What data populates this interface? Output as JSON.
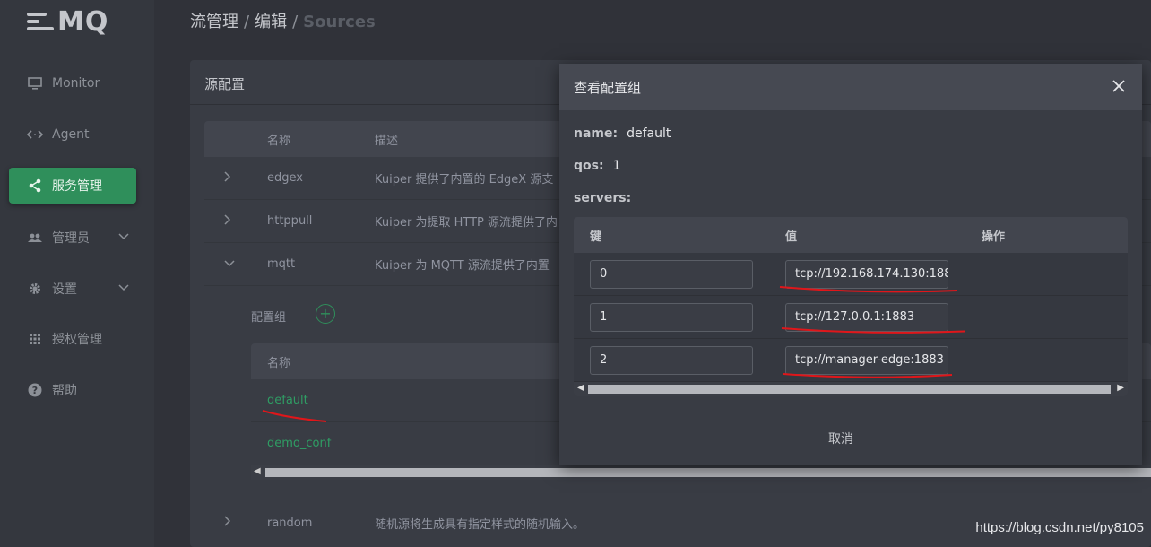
{
  "sidebar": {
    "logo": "MQ",
    "items": [
      {
        "label": "Monitor",
        "icon": "monitor-icon"
      },
      {
        "label": "Agent",
        "icon": "code-icon"
      },
      {
        "label": "服务管理",
        "icon": "share-icon",
        "active": true
      },
      {
        "label": "管理员",
        "icon": "users-icon",
        "expandable": true
      },
      {
        "label": "设置",
        "icon": "gear-icon",
        "expandable": true
      },
      {
        "label": "授权管理",
        "icon": "grid-icon"
      },
      {
        "label": "帮助",
        "icon": "help-icon"
      }
    ]
  },
  "breadcrumb": {
    "items": [
      "流管理",
      "编辑"
    ],
    "current": "Sources",
    "separator": "/"
  },
  "card": {
    "title": "源配置",
    "table": {
      "headers": [
        "名称",
        "描述"
      ],
      "rows": [
        {
          "name": "edgex",
          "desc": "Kuiper 提供了内置的 EdgeX 源支"
        },
        {
          "name": "httppull",
          "desc": "Kuiper 为提取 HTTP 源流提供了内"
        },
        {
          "name": "mqtt",
          "desc": "Kuiper 为 MQTT 源流提供了内置"
        }
      ],
      "random_row": {
        "name": "random",
        "desc": "随机源将生成具有指定样式的随机输入。"
      }
    },
    "config_group": {
      "label": "配置组",
      "add": "+",
      "header": "名称",
      "rows": [
        "default",
        "demo_conf"
      ]
    }
  },
  "modal": {
    "title": "查看配置组",
    "close": "×",
    "fields": [
      {
        "key": "name:",
        "value": "default"
      },
      {
        "key": "qos:",
        "value": "1"
      }
    ],
    "servers_label": "servers:",
    "servers": {
      "headers": [
        "键",
        "值",
        "操作"
      ],
      "rows": [
        {
          "key": "0",
          "value": "tcp://192.168.174.130:188"
        },
        {
          "key": "1",
          "value": "tcp://127.0.0.1:1883"
        },
        {
          "key": "2",
          "value": "tcp://manager-edge:1883"
        }
      ]
    },
    "cancel": "取消"
  },
  "watermark": "https://blog.csdn.net/py8105",
  "colors": {
    "accent": "#2f8f5b",
    "annotation": "#e0161a",
    "link": "#2f9d64"
  }
}
